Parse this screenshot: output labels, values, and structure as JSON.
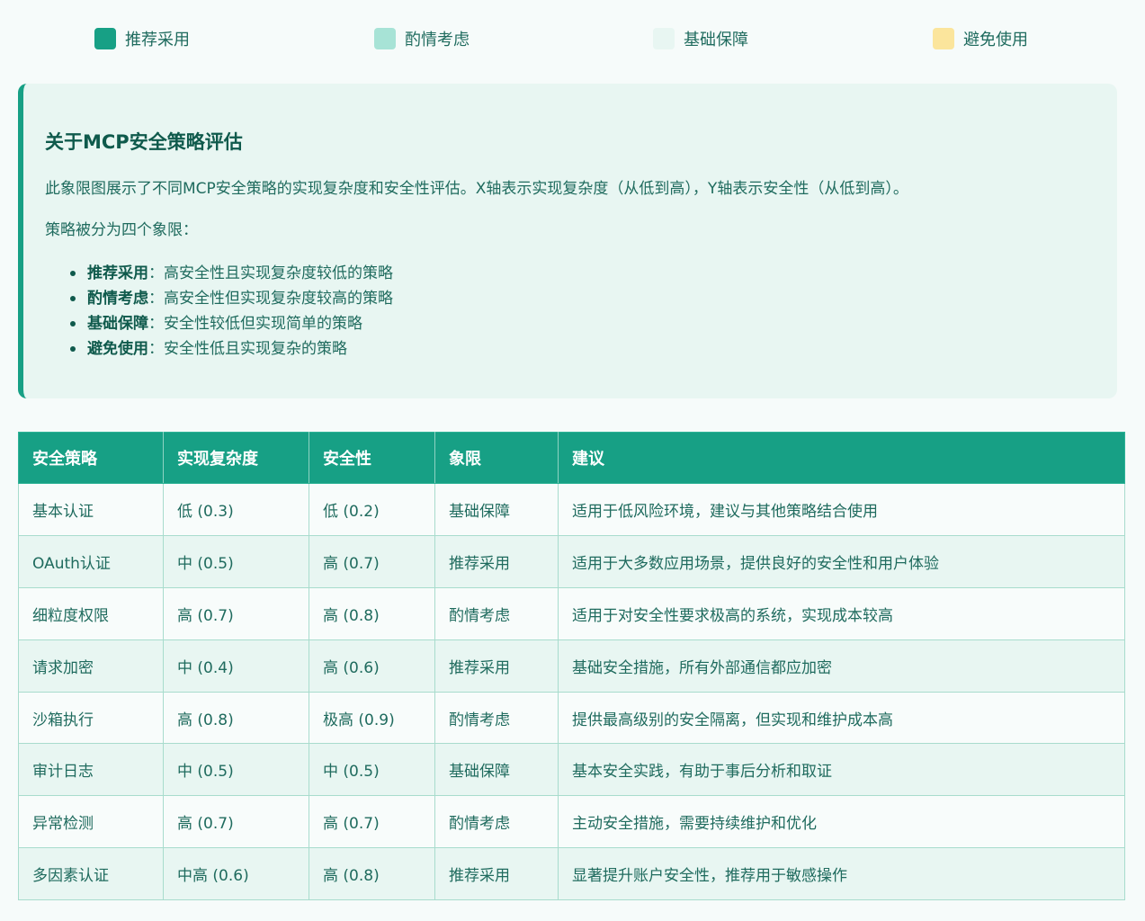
{
  "legend": [
    {
      "label": "推荐采用",
      "color": "#17a085"
    },
    {
      "label": "酌情考虑",
      "color": "#a7e3d6"
    },
    {
      "label": "基础保障",
      "color": "#e8f6f2"
    },
    {
      "label": "避免使用",
      "color": "#fbe59c"
    }
  ],
  "info": {
    "title": "关于MCP安全策略评估",
    "description": "此象限图展示了不同MCP安全策略的实现复杂度和安全性评估。X轴表示实现复杂度（从低到高），Y轴表示安全性（从低到高）。",
    "intro": "策略被分为四个象限：",
    "quadrants": [
      {
        "term": "推荐采用",
        "sep": "：",
        "desc": "高安全性且实现复杂度较低的策略"
      },
      {
        "term": "酌情考虑",
        "sep": "：",
        "desc": "高安全性但实现复杂度较高的策略"
      },
      {
        "term": "基础保障",
        "sep": "：",
        "desc": "安全性较低但实现简单的策略"
      },
      {
        "term": "避免使用",
        "sep": "：",
        "desc": "安全性低且实现复杂的策略"
      }
    ]
  },
  "table": {
    "headers": [
      "安全策略",
      "实现复杂度",
      "安全性",
      "象限",
      "建议"
    ],
    "rows": [
      [
        "基本认证",
        "低 (0.3)",
        "低 (0.2)",
        "基础保障",
        "适用于低风险环境，建议与其他策略结合使用"
      ],
      [
        "OAuth认证",
        "中 (0.5)",
        "高 (0.7)",
        "推荐采用",
        "适用于大多数应用场景，提供良好的安全性和用户体验"
      ],
      [
        "细粒度权限",
        "高 (0.7)",
        "高 (0.8)",
        "酌情考虑",
        "适用于对安全性要求极高的系统，实现成本较高"
      ],
      [
        "请求加密",
        "中 (0.4)",
        "高 (0.6)",
        "推荐采用",
        "基础安全措施，所有外部通信都应加密"
      ],
      [
        "沙箱执行",
        "高 (0.8)",
        "极高 (0.9)",
        "酌情考虑",
        "提供最高级别的安全隔离，但实现和维护成本高"
      ],
      [
        "审计日志",
        "中 (0.5)",
        "中 (0.5)",
        "基础保障",
        "基本安全实践，有助于事后分析和取证"
      ],
      [
        "异常检测",
        "高 (0.7)",
        "高 (0.7)",
        "酌情考虑",
        "主动安全措施，需要持续维护和优化"
      ],
      [
        "多因素认证",
        "中高 (0.6)",
        "高 (0.8)",
        "推荐采用",
        "显著提升账户安全性，推荐用于敏感操作"
      ]
    ]
  }
}
